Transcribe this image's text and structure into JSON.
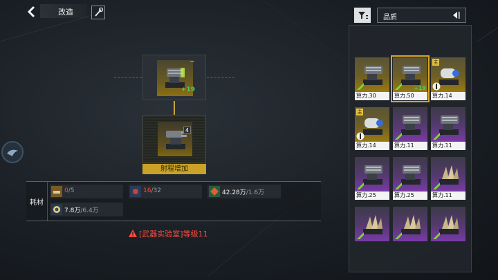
{
  "header": {
    "title": "改造"
  },
  "upgrade": {
    "current_item": {
      "count": "",
      "plus_label": "+19"
    },
    "result_item": {
      "count": "4"
    },
    "effect_label": "射程增加"
  },
  "materials": {
    "title": "耗材",
    "items": [
      {
        "have": "0",
        "need": "/5",
        "icon": "cannon-part-icon"
      },
      {
        "have": "16",
        "need": "/32",
        "icon": "component-icon"
      },
      {
        "have": "42.28万",
        "need": "/1.6万",
        "icon": "ore-icon"
      },
      {
        "have": "7.8万",
        "need": "/6.4万",
        "icon": "coin-icon"
      }
    ]
  },
  "warning": "[武器实验室]等级11",
  "panel": {
    "sort_label": "品质",
    "cards": [
      {
        "power": "算力.30",
        "quality": "gold",
        "main": false,
        "plus": ""
      },
      {
        "power": "算力.50",
        "quality": "gold",
        "main": false,
        "plus": "+19",
        "selected": true
      },
      {
        "power": "算力.14",
        "quality": "gold",
        "main": true,
        "plus": ""
      },
      {
        "power": "算力.14",
        "quality": "gold",
        "main": true,
        "plus": ""
      },
      {
        "power": "算力.11",
        "quality": "purple",
        "main": false,
        "plus": ""
      },
      {
        "power": "算力.11",
        "quality": "purple",
        "main": false,
        "plus": ""
      },
      {
        "power": "算力.25",
        "quality": "purple",
        "main": false,
        "plus": ""
      },
      {
        "power": "算力.25",
        "quality": "purple",
        "main": false,
        "plus": ""
      },
      {
        "power": "算力.11",
        "quality": "purple",
        "main": false,
        "plus": ""
      },
      {
        "power": "",
        "quality": "purple",
        "main": false,
        "plus": ""
      },
      {
        "power": "",
        "quality": "purple",
        "main": false,
        "plus": ""
      },
      {
        "power": "",
        "quality": "purple",
        "main": false,
        "plus": ""
      }
    ],
    "main_tag": "主"
  },
  "colors": {
    "gold": "#c9a227",
    "warning_red": "#ff4a3a",
    "level_green": "#3fd26a",
    "purple": "#7a3aa8"
  }
}
